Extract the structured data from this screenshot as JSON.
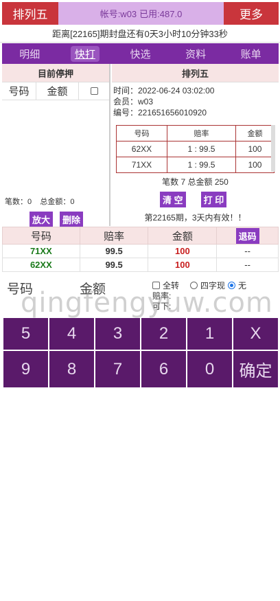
{
  "topbar": {
    "game": "排列五",
    "account_label": "帐号:w03",
    "used_label": "已用:487.0",
    "more": "更多"
  },
  "countdown": "距离[22165]期封盘还有0天3小时10分钟33秒",
  "tabs": [
    "明细",
    "快打",
    "快选",
    "资料",
    "账单"
  ],
  "left": {
    "title": "目前停押",
    "col_number": "号码",
    "col_amount": "金额",
    "count_label": "笔数：0",
    "total_label": "总金额：0",
    "zoom_btn": "放大",
    "delete_btn": "删除"
  },
  "right": {
    "title": "排列五",
    "time": "时间：2022-06-24 03:02:00",
    "member": "会员：w03",
    "serial": "编号：221651656010920",
    "headers": [
      "号码",
      "赔率",
      "金额"
    ],
    "rows": [
      [
        "62XX",
        "1 : 99.5",
        "100"
      ],
      [
        "71XX",
        "1 : 99.5",
        "100"
      ]
    ],
    "summary": "笔数 7 总金额 250",
    "clear_btn": "清 空",
    "print_btn": "打 印",
    "note": "第22165期，3天内有效！！"
  },
  "bets": {
    "headers": [
      "号码",
      "赔率",
      "金额"
    ],
    "refund_btn": "退码",
    "rows": [
      {
        "number": "71XX",
        "odds": "99.5",
        "amount": "100",
        "action": "--"
      },
      {
        "number": "62XX",
        "odds": "99.5",
        "amount": "100",
        "action": "--"
      }
    ]
  },
  "entry": {
    "number_label": "号码",
    "amount_label": "金额",
    "opt_all": "全转",
    "opt_four": "四字现",
    "opt_none": "无",
    "odds_label": "赔率:",
    "max_label": "可下:"
  },
  "watermark": "qingfengyuw.com",
  "keypad": [
    "5",
    "4",
    "3",
    "2",
    "1",
    "X",
    "9",
    "8",
    "7",
    "6",
    "0",
    "确定"
  ]
}
